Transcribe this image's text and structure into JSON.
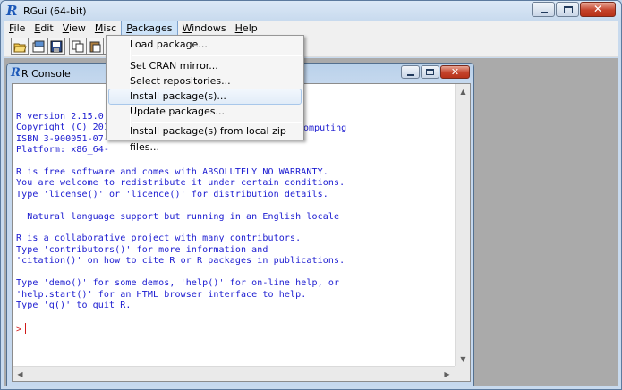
{
  "window": {
    "title": "RGui (64-bit)",
    "logo_text": "R"
  },
  "menubar": [
    {
      "label": "File",
      "key": "F"
    },
    {
      "label": "Edit",
      "key": "E"
    },
    {
      "label": "View",
      "key": "V"
    },
    {
      "label": "Misc",
      "key": "M"
    },
    {
      "label": "Packages",
      "key": "P"
    },
    {
      "label": "Windows",
      "key": "W"
    },
    {
      "label": "Help",
      "key": "H"
    }
  ],
  "packages_menu": {
    "items": [
      {
        "label": "Load package..."
      },
      {
        "label": "Set CRAN mirror..."
      },
      {
        "label": "Select repositories..."
      },
      {
        "label": "Install package(s)..."
      },
      {
        "label": "Update packages..."
      },
      {
        "label": "Install package(s) from local zip files..."
      }
    ],
    "highlighted_index": 3
  },
  "console": {
    "title": "R Console",
    "lines": [
      "R version 2.15.0",
      "Copyright (C) 201",
      "ISBN 3-900051-07-",
      "Platform: x86_64-",
      "",
      "R is free software and comes with ABSOLUTELY NO WARRANTY.",
      "You are welcome to redistribute it under certain conditions.",
      "Type 'license()' or 'licence()' for distribution details.",
      "",
      "  Natural language support but running in an English locale",
      "",
      "R is a collaborative project with many contributors.",
      "Type 'contributors()' for more information and",
      "'citation()' on how to cite R or R packages in publications.",
      "",
      "Type 'demo()' for some demos, 'help()' for on-line help, or",
      "'help.start()' for an HTML browser interface to help.",
      "Type 'q()' to quit R.",
      ""
    ],
    "hidden_fragment": "Computing",
    "prompt": ">"
  },
  "colors": {
    "console_text": "#1a1ad0",
    "prompt": "#d01a1a",
    "mdi_background": "#aaaaaa"
  }
}
